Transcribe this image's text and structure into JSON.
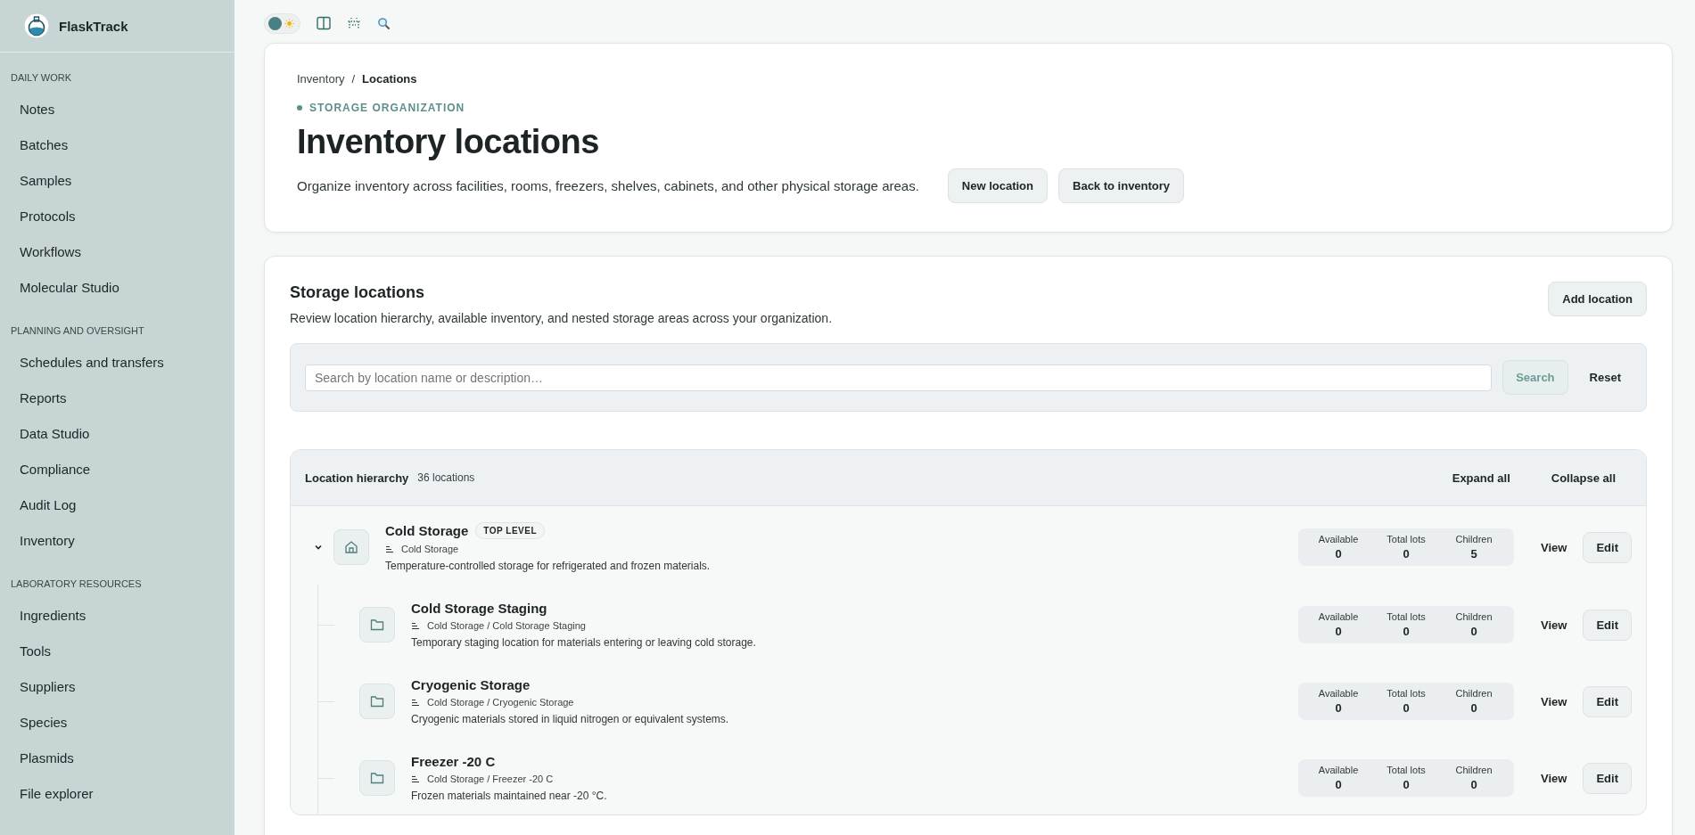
{
  "app": {
    "name": "FlaskTrack"
  },
  "sidebar": {
    "sections": [
      {
        "title": "DAILY WORK",
        "items": [
          {
            "label": "Notes",
            "selected": false
          },
          {
            "label": "Batches",
            "selected": false
          },
          {
            "label": "Samples",
            "selected": false
          },
          {
            "label": "Protocols",
            "selected": false
          },
          {
            "label": "Workflows",
            "selected": false
          },
          {
            "label": "Molecular Studio",
            "selected": false
          }
        ]
      },
      {
        "title": "PLANNING AND OVERSIGHT",
        "items": [
          {
            "label": "Schedules and transfers",
            "selected": false
          },
          {
            "label": "Reports",
            "selected": false
          },
          {
            "label": "Data Studio",
            "selected": false
          },
          {
            "label": "Compliance",
            "selected": false
          },
          {
            "label": "Audit Log",
            "selected": false
          },
          {
            "label": "Inventory",
            "selected": false
          }
        ]
      },
      {
        "title": "LABORATORY RESOURCES",
        "items": [
          {
            "label": "Ingredients",
            "selected": false
          },
          {
            "label": "Tools",
            "selected": false
          },
          {
            "label": "Suppliers",
            "selected": false
          },
          {
            "label": "Species",
            "selected": false
          },
          {
            "label": "Plasmids",
            "selected": false
          },
          {
            "label": "File explorer",
            "selected": false
          }
        ]
      }
    ]
  },
  "toolbar": {
    "theme_toggle": {
      "on": false
    }
  },
  "header": {
    "breadcrumb": [
      "Inventory",
      "Locations"
    ],
    "separator": "/",
    "eyebrow": "STORAGE ORGANIZATION",
    "title": "Inventory locations",
    "description": "Organize inventory across facilities, rooms, freezers, shelves, cabinets, and other physical storage areas.",
    "buttons": [
      "New location",
      "Back to inventory"
    ]
  },
  "storage": {
    "title": "Storage locations",
    "description": "Review location hierarchy, available inventory, and nested storage areas across your organization.",
    "add_button": "Add location",
    "search": {
      "placeholder": "Search by location name or description…",
      "search_button": "Search",
      "reset_button": "Reset"
    },
    "hierarchy": {
      "title": "Location hierarchy",
      "count": "36 locations",
      "expand_all": "Expand all",
      "collapse_all": "Collapse all",
      "locations": [
        {
          "kind": "building",
          "name": "Cold Storage",
          "badge": "TOP LEVEL",
          "path": "Cold Storage",
          "description": "Temperature-controlled storage for refrigerated and frozen materials.",
          "stats": [
            {
              "label": "Available",
              "value": "0"
            },
            {
              "label": "Total lots",
              "value": "0"
            },
            {
              "label": "Children",
              "value": "5"
            }
          ],
          "view": "View",
          "edit": "Edit",
          "expanded": true,
          "children": [
            {
              "kind": "folder",
              "name": "Cold Storage Staging",
              "path": "Cold Storage / Cold Storage Staging",
              "description": "Temporary staging location for materials entering or leaving cold storage.",
              "stats": [
                {
                  "label": "Available",
                  "value": "0"
                },
                {
                  "label": "Total lots",
                  "value": "0"
                },
                {
                  "label": "Children",
                  "value": "0"
                }
              ],
              "view": "View",
              "edit": "Edit"
            },
            {
              "kind": "folder",
              "name": "Cryogenic Storage",
              "path": "Cold Storage / Cryogenic Storage",
              "description": "Cryogenic materials stored in liquid nitrogen or equivalent systems.",
              "stats": [
                {
                  "label": "Available",
                  "value": "0"
                },
                {
                  "label": "Total lots",
                  "value": "0"
                },
                {
                  "label": "Children",
                  "value": "0"
                }
              ],
              "view": "View",
              "edit": "Edit"
            },
            {
              "kind": "folder",
              "name": "Freezer -20 C",
              "path": "Cold Storage / Freezer -20 C",
              "description": "Frozen materials maintained near -20 °C.",
              "stats": [
                {
                  "label": "Available",
                  "value": "0"
                },
                {
                  "label": "Total lots",
                  "value": "0"
                },
                {
                  "label": "Children",
                  "value": "0"
                }
              ],
              "view": "View",
              "edit": "Edit"
            }
          ]
        }
      ]
    }
  }
}
